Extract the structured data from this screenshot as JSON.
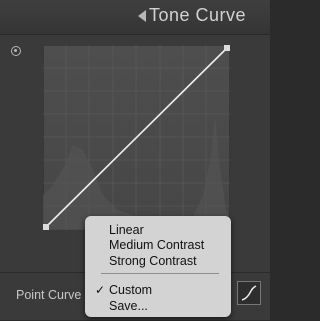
{
  "header": {
    "title": "Tone Curve",
    "collapse_icon": "triangle-left-icon"
  },
  "panel": {
    "target_adjustment_icon": "target-adjust-icon"
  },
  "footer": {
    "point_curve_label": "Point Curve",
    "edit_curve_icon": "curve-edit-icon"
  },
  "dropdown": {
    "items": [
      {
        "label": "Linear"
      },
      {
        "label": "Medium Contrast"
      },
      {
        "label": "Strong Contrast"
      },
      {
        "label": "Custom",
        "checked": true
      },
      {
        "label": "Save..."
      }
    ],
    "check_glyph": "✓"
  },
  "curve": {
    "type": "linear",
    "points": [
      [
        0,
        0
      ],
      [
        255,
        255
      ]
    ]
  }
}
